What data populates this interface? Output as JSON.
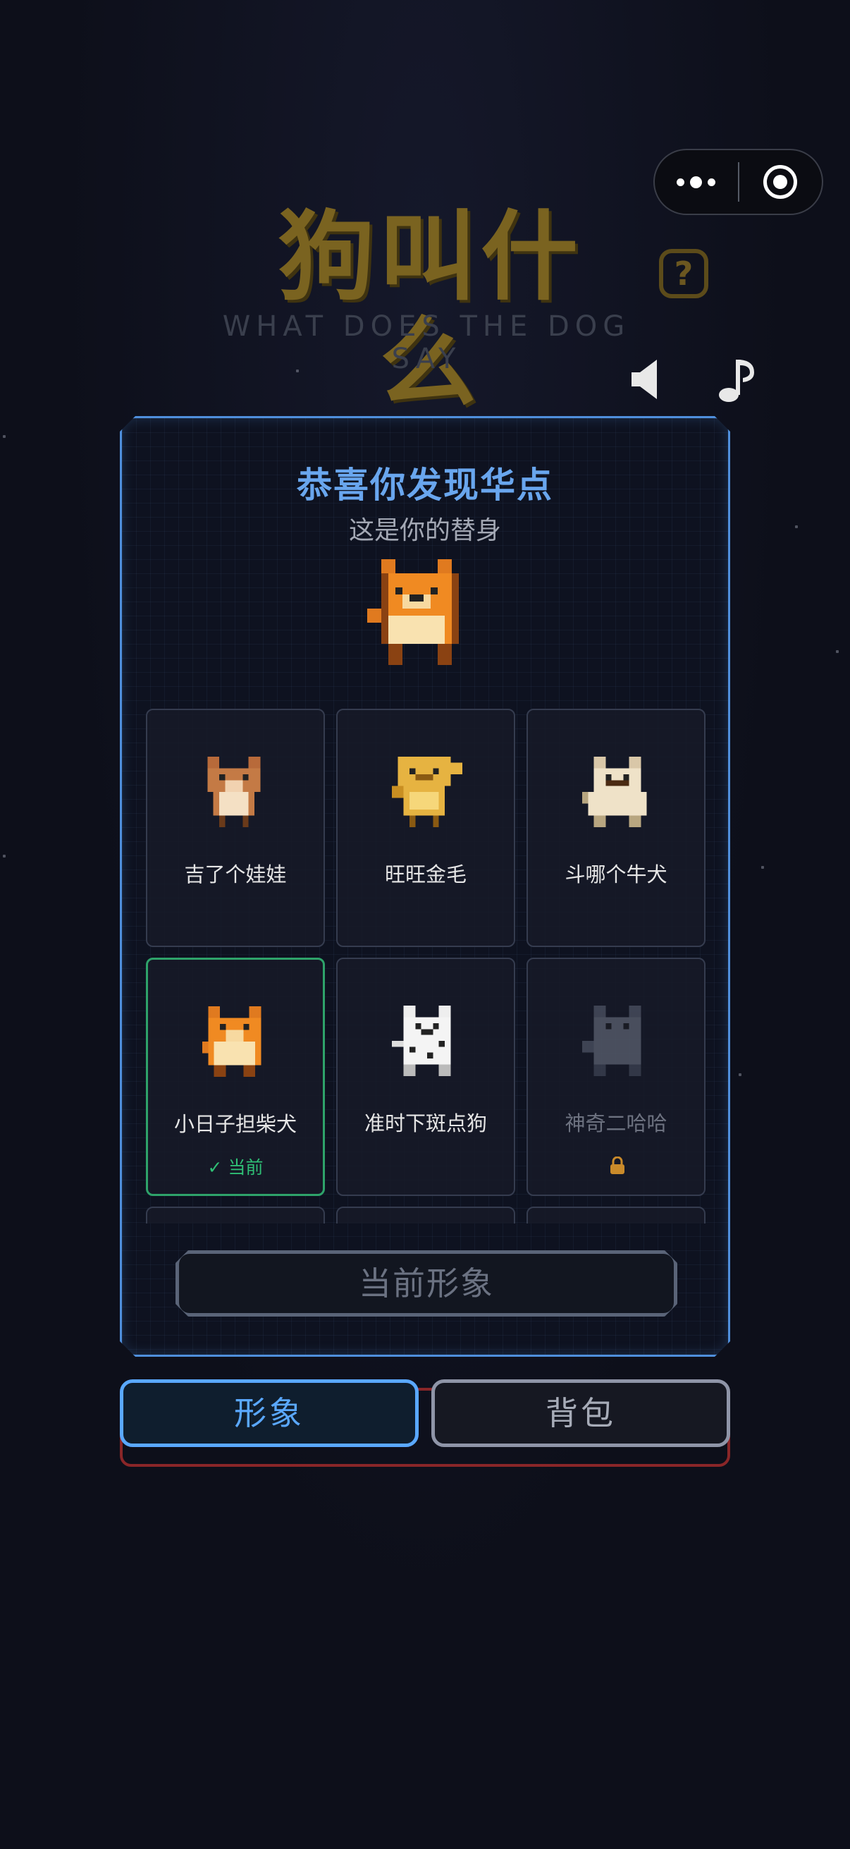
{
  "capsule": {
    "more_icon": "more-dots-icon",
    "close_icon": "target-circle-icon"
  },
  "header": {
    "title": "狗叫什么",
    "subtitle": "WHAT DOES THE DOG SAY",
    "help_label": "?",
    "sound_icon": "speaker-icon",
    "music_icon": "music-note-icon"
  },
  "panel": {
    "heading": "恭喜你发现华点",
    "subheading": "这是你的替身",
    "characters": [
      {
        "name": "吉了个娃娃",
        "status": ""
      },
      {
        "name": "旺旺金毛",
        "status": ""
      },
      {
        "name": "斗哪个牛犬",
        "status": ""
      },
      {
        "name": "小日子担柴犬",
        "status": "✓ 当前"
      },
      {
        "name": "准时下斑点狗",
        "status": ""
      },
      {
        "name": "神奇二哈哈",
        "status": ""
      }
    ],
    "current_button": "当前形象"
  },
  "tabs": {
    "avatar": "形象",
    "bag": "背包"
  },
  "colors": {
    "accent": "#5aa8ff",
    "current": "#2ea36a",
    "title": "#7a6320",
    "danger": "#8a2628"
  }
}
